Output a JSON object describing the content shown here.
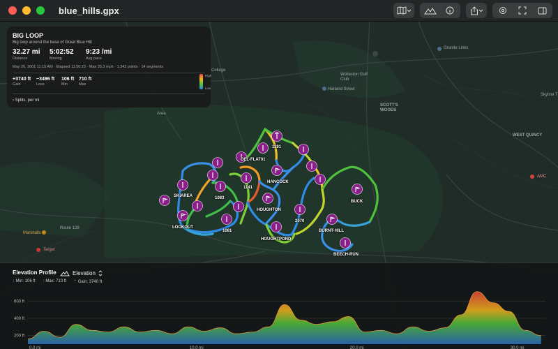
{
  "window": {
    "title": "blue_hills.gpx"
  },
  "colors": {
    "pin": "#8a1f8a",
    "background": "#1e2a27",
    "panel": "#191b1b"
  },
  "toolbar": {
    "buttons": [
      {
        "name": "map-style-button",
        "icon": "map-icon"
      },
      {
        "name": "elevation-toggle-button",
        "icon": "mountain-icon"
      },
      {
        "name": "info-button",
        "icon": "info-icon"
      },
      {
        "name": "share-button",
        "icon": "share-icon"
      },
      {
        "name": "settings-button",
        "icon": "gear-icon"
      },
      {
        "name": "fullscreen-button",
        "icon": "expand-icon"
      }
    ]
  },
  "stats": {
    "name": "BIG LOOP",
    "description": "Big loop around the base of Great Blue Hill",
    "distance": {
      "value": "32.27 mi",
      "label": "Distance"
    },
    "moving": {
      "value": "5:02:52",
      "label": "Moving"
    },
    "pace": {
      "value": "9:23 /mi",
      "label": "Avg pace"
    },
    "meta": "May 26, 2001 11:15 AM   ·   Elapsed 11:50:23   ·   Max 35.3 mph   ·   1,343 points · 14 segments",
    "gain": {
      "value": "+3740 ft",
      "label": "Gain"
    },
    "loss": {
      "value": "−3496 ft",
      "label": "Loss"
    },
    "min": {
      "value": "106 ft",
      "label": "Min"
    },
    "max": {
      "value": "710 ft",
      "label": "Max"
    },
    "legend_high": "High",
    "legend_low": "Low",
    "splits_label": "Splits, per mi"
  },
  "map_labels": [
    {
      "text": "Granite Links"
    },
    {
      "text": "College"
    },
    {
      "text": "Wollaston Golf Club"
    },
    {
      "text": "Harland Street"
    },
    {
      "text": "SCOTT'S WOODS"
    },
    {
      "text": "WEST QUINCY"
    },
    {
      "text": "Skyline T"
    },
    {
      "text": "AMC"
    },
    {
      "text": "Route 128"
    },
    {
      "text": "Marshalls"
    },
    {
      "text": "Target"
    },
    {
      "text": "Area"
    }
  ],
  "waypoints": [
    {
      "label": "1191"
    },
    {
      "label": "DEL-FLAT01"
    },
    {
      "label": "HANCOCK"
    },
    {
      "label": "1141"
    },
    {
      "label": "SKIAREA"
    },
    {
      "label": "1083"
    },
    {
      "label": "HOUGHTON"
    },
    {
      "label": "BUCK"
    },
    {
      "label": "LOOKOUT"
    },
    {
      "label": "1081"
    },
    {
      "label": "2070"
    },
    {
      "label": "BURNT-HILL"
    },
    {
      "label": "HOUGHTPOND"
    },
    {
      "label": "BEECH-RUN"
    }
  ],
  "profile": {
    "title": "Elevation Profile",
    "mode": "Elevation",
    "min_label": "Min: 106 ft",
    "max_label": "Max: 710 ft",
    "gain_label": "Gain: 3740 ft",
    "y_ticks": [
      "600 ft",
      "400 ft",
      "200 ft"
    ],
    "x_ticks": [
      "0.0 mi",
      "10.0 mi",
      "20.0 mi",
      "30.0 mi"
    ]
  },
  "chart_data": {
    "type": "area",
    "title": "Elevation Profile",
    "xlabel": "",
    "ylabel": "",
    "x_unit": "mi",
    "y_unit": "ft",
    "xlim": [
      0,
      32.27
    ],
    "ylim": [
      100,
      700
    ],
    "x": [
      0,
      1,
      2,
      3,
      4,
      5,
      6,
      7,
      8,
      9,
      10,
      11,
      12,
      13,
      14,
      15,
      16,
      17,
      18,
      19,
      20,
      21,
      22,
      23,
      24,
      25,
      26,
      27,
      28,
      29,
      30,
      31,
      32
    ],
    "values": [
      160,
      250,
      180,
      330,
      260,
      240,
      300,
      240,
      260,
      220,
      300,
      250,
      290,
      220,
      240,
      300,
      560,
      380,
      330,
      360,
      420,
      240,
      260,
      220,
      300,
      250,
      290,
      440,
      710,
      580,
      480,
      260,
      200
    ]
  }
}
